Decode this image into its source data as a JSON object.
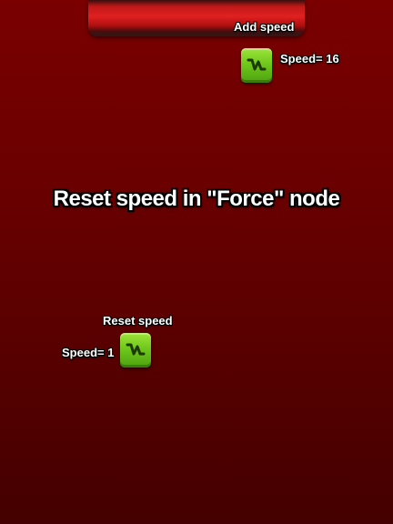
{
  "add_speed": {
    "title": "Add speed",
    "value_label": "Speed= 16",
    "icon": "speed-block-icon"
  },
  "instruction": "Reset speed in \"Force\" node",
  "reset_speed": {
    "title": "Reset speed",
    "value_label": "Speed= 1",
    "icon": "speed-block-icon"
  },
  "colors": {
    "background_top": "#7a0000",
    "background_bottom": "#440000",
    "block_green": "#6fc81c",
    "bar_red": "#e02020"
  }
}
